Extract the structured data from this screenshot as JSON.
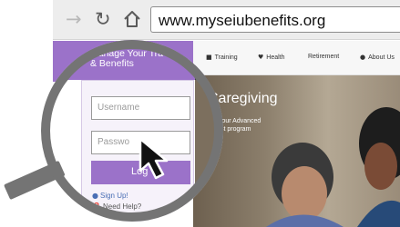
{
  "browser": {
    "back_icon": "back-arrow-icon",
    "reload_icon": "reload-icon",
    "home_icon": "home-icon",
    "url": "www.myseiubenefits.org"
  },
  "site": {
    "nav": [
      {
        "icon": "graduation-cap-icon",
        "label": "Training"
      },
      {
        "icon": "heart-icon",
        "label": "Health"
      },
      {
        "icon": "",
        "label": "Retirement"
      },
      {
        "icon": "info-icon",
        "label": "About Us"
      }
    ],
    "hero": {
      "title": "Caregiving",
      "line1": "fy for our Advanced",
      "line2": "ecialist program"
    }
  },
  "login_panel": {
    "title_line1": "Manage Your Tra",
    "title_line2": "& Benefits",
    "username_placeholder": "Username",
    "password_value": "Passwo",
    "login_label": "Log",
    "signup_label": "Sign Up!",
    "help_label": "Need Help?"
  },
  "overlay": {
    "magnifier_icon": "magnifying-glass-icon",
    "cursor_icon": "mouse-pointer-icon"
  },
  "colors": {
    "brand_purple": "#9b72c9",
    "magnifier_gray": "#747474"
  }
}
